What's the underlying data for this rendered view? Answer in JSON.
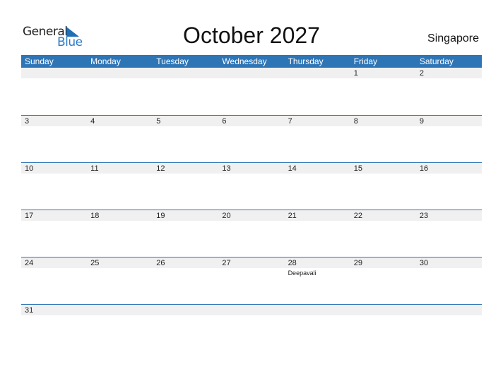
{
  "logo": {
    "word1": "General",
    "word2": "Blue",
    "icon": "triangle-flag-icon"
  },
  "title": "October 2027",
  "country": "Singapore",
  "colors": {
    "header_bg": "#2e75b6",
    "band_bg": "#f0f0f0",
    "logo_blue": "#2a7bc8"
  },
  "weekdays": [
    "Sunday",
    "Monday",
    "Tuesday",
    "Wednesday",
    "Thursday",
    "Friday",
    "Saturday"
  ],
  "weeks": [
    [
      {
        "d": ""
      },
      {
        "d": ""
      },
      {
        "d": ""
      },
      {
        "d": ""
      },
      {
        "d": ""
      },
      {
        "d": "1"
      },
      {
        "d": "2"
      }
    ],
    [
      {
        "d": "3"
      },
      {
        "d": "4"
      },
      {
        "d": "5"
      },
      {
        "d": "6"
      },
      {
        "d": "7"
      },
      {
        "d": "8"
      },
      {
        "d": "9"
      }
    ],
    [
      {
        "d": "10"
      },
      {
        "d": "11"
      },
      {
        "d": "12"
      },
      {
        "d": "13"
      },
      {
        "d": "14"
      },
      {
        "d": "15"
      },
      {
        "d": "16"
      }
    ],
    [
      {
        "d": "17"
      },
      {
        "d": "18"
      },
      {
        "d": "19"
      },
      {
        "d": "20"
      },
      {
        "d": "21"
      },
      {
        "d": "22"
      },
      {
        "d": "23"
      }
    ],
    [
      {
        "d": "24"
      },
      {
        "d": "25"
      },
      {
        "d": "26"
      },
      {
        "d": "27"
      },
      {
        "d": "28",
        "h": "Deepavali"
      },
      {
        "d": "29"
      },
      {
        "d": "30"
      }
    ],
    [
      {
        "d": "31"
      },
      {
        "d": ""
      },
      {
        "d": ""
      },
      {
        "d": ""
      },
      {
        "d": ""
      },
      {
        "d": ""
      },
      {
        "d": ""
      }
    ]
  ]
}
